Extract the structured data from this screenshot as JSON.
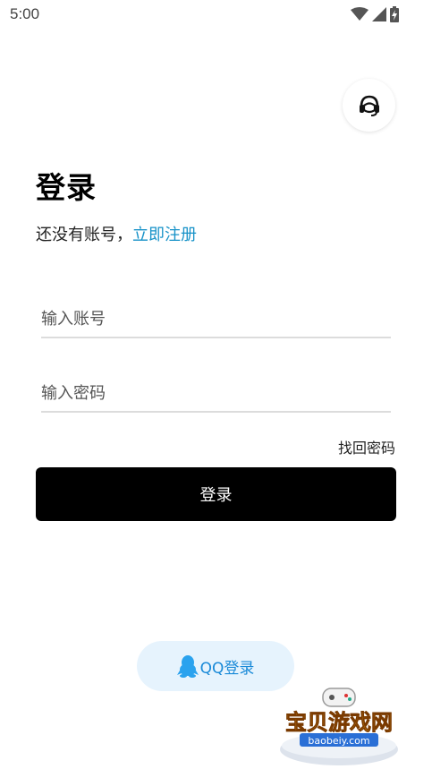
{
  "status_bar": {
    "time": "5:00",
    "icons": [
      "wifi-icon",
      "cell-signal-icon",
      "battery-charging-icon"
    ]
  },
  "support": {
    "icon": "customer-service-headset-icon"
  },
  "page": {
    "title": "登录",
    "register_prompt": "还没有账号，",
    "register_link": "立即注册"
  },
  "form": {
    "account_placeholder": "输入账号",
    "account_value": "",
    "password_placeholder": "输入密码",
    "password_value": "",
    "forgot_password": "找回密码",
    "login_label": "登录"
  },
  "third_party": {
    "qq_label": "QQ登录",
    "qq_icon": "qq-penguin-icon"
  },
  "watermark": {
    "title": "宝贝游戏网",
    "url": "baobeiy.com"
  },
  "colors": {
    "link": "#1792c8",
    "primary_button": "#000000",
    "qq_button_bg": "#e6f3fd",
    "qq_text": "#1a8ad8"
  }
}
